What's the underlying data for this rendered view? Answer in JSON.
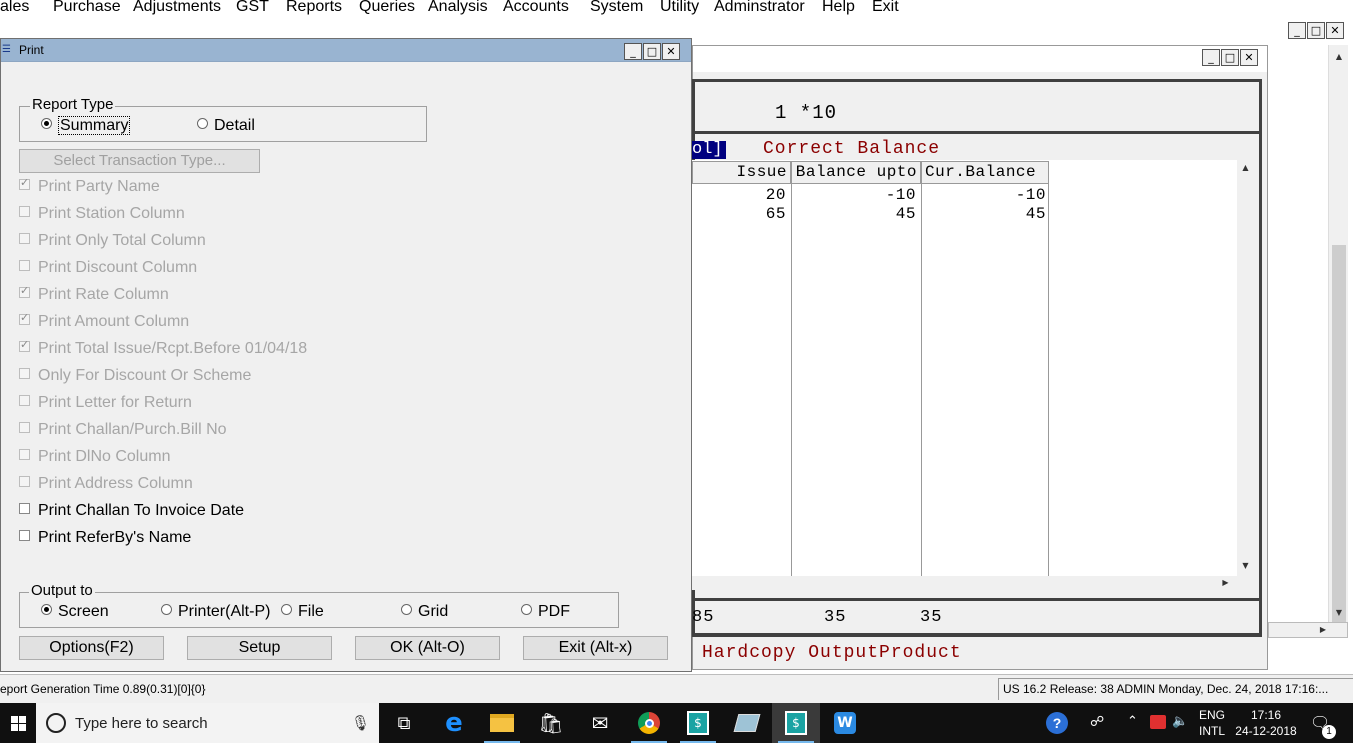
{
  "menu": [
    "ales",
    "Purchase",
    "Adjustments",
    "GST",
    "Reports",
    "Queries",
    "Analysis",
    "Accounts",
    "System",
    "Utility",
    "Adminstrator",
    "Help",
    "Exit"
  ],
  "window_buttons": {
    "minimize": "_",
    "maximize": "□",
    "close": "✕"
  },
  "dialog": {
    "title": "Print",
    "report_type": {
      "label": "Report Type",
      "options": [
        "Summary",
        "Detail"
      ],
      "selected": "Summary"
    },
    "select_transaction_button": "Select Transaction Type...",
    "checkboxes": [
      {
        "label": "Print Party Name",
        "checked": true,
        "enabled": false
      },
      {
        "label": "Print Station Column",
        "checked": false,
        "enabled": false
      },
      {
        "label": "Print Only Total Column",
        "checked": false,
        "enabled": false
      },
      {
        "label": "Print Discount Column",
        "checked": false,
        "enabled": false
      },
      {
        "label": "Print Rate Column",
        "checked": true,
        "enabled": false
      },
      {
        "label": "Print Amount Column",
        "checked": true,
        "enabled": false
      },
      {
        "label": "Print Total Issue/Rcpt.Before 01/04/18",
        "checked": true,
        "enabled": false
      },
      {
        "label": "Only For Discount Or Scheme",
        "checked": false,
        "enabled": false
      },
      {
        "label": "Print Letter for Return",
        "checked": false,
        "enabled": false
      },
      {
        "label": "Print Challan/Purch.Bill No",
        "checked": false,
        "enabled": false
      },
      {
        "label": "Print DlNo Column",
        "checked": false,
        "enabled": false
      },
      {
        "label": "Print Address Column",
        "checked": false,
        "enabled": false
      },
      {
        "label": "Print Challan To Invoice Date",
        "checked": false,
        "enabled": true
      },
      {
        "label": "Print ReferBy's Name",
        "checked": false,
        "enabled": true
      }
    ],
    "output_to": {
      "label": "Output to",
      "options": [
        "Screen",
        "Printer(Alt-P)",
        "File",
        "Grid",
        "PDF"
      ],
      "selected": "Screen"
    },
    "buttons": {
      "options": "Options(F2)",
      "setup": "Setup",
      "ok": "OK (Alt-O)",
      "exit": "Exit (Alt-x)"
    }
  },
  "report": {
    "header_line": "1 *10",
    "highlight_text": "ol]",
    "red_title": "Correct Balance",
    "columns": [
      "Issue",
      "Balance upto",
      "Cur.Balance"
    ],
    "rows": [
      [
        "20",
        "-10",
        "-10"
      ],
      [
        "65",
        "45",
        "45"
      ]
    ],
    "totals": [
      "85",
      "35",
      "35"
    ],
    "bottom_text": "Hardcopy OutputProduct"
  },
  "status": {
    "left": "eport Generation Time 0.89(0.31)[0]{0}",
    "right": "US 16.2 Release: 38 ADMIN  Monday, Dec. 24, 2018  17:16:..."
  },
  "taskbar": {
    "search_placeholder": "Type here to search",
    "language": "ENG",
    "language_sub": "INTL",
    "time": "17:16",
    "date": "24-12-2018",
    "notification_count": "1"
  }
}
